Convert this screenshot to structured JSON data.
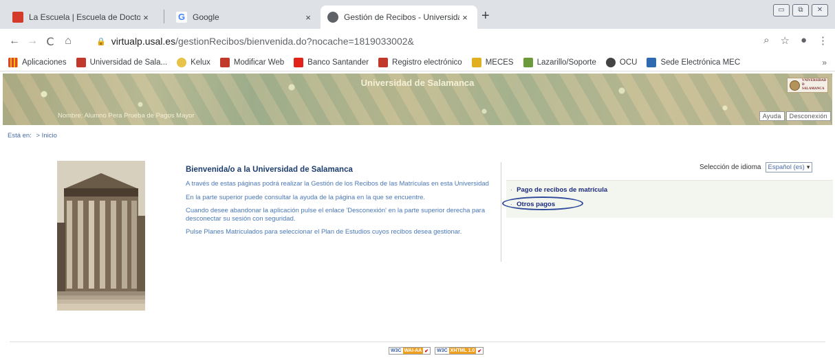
{
  "tabs": [
    {
      "title": "La Escuela | Escuela de Doctorado",
      "favicon_color": "#d43a2a",
      "active": false
    },
    {
      "title": "Google",
      "favicon_color": "#4285f4",
      "active": false
    },
    {
      "title": "Gestión de Recibos - Universidad",
      "favicon_color": "#5f6368",
      "active": true
    }
  ],
  "icons": {
    "close": "×",
    "new_tab": "+",
    "back": "←",
    "forward": "→",
    "reload": "C",
    "home": "⌂",
    "lock": "🔒",
    "zoom": "⌕",
    "star": "☆",
    "profile": "●",
    "menu": "⋮",
    "more": "»",
    "minimize": "▭",
    "restore": "⧉",
    "win_close": "✕",
    "bullet": "·",
    "chevron": "▾"
  },
  "address": {
    "host": "virtualp.usal.es",
    "path": "/gestionRecibos/bienvenida.do?nocache=1819033002&"
  },
  "bookmarks": [
    {
      "label": "Aplicaciones",
      "color": "#db4437"
    },
    {
      "label": "Universidad de Sala...",
      "color": "#c0392b"
    },
    {
      "label": "Kelux",
      "color": "#e8c34a"
    },
    {
      "label": "Modificar Web",
      "color": "#c0392b"
    },
    {
      "label": "Banco Santander",
      "color": "#e2231a"
    },
    {
      "label": "Registro electrónico",
      "color": "#c0392b"
    },
    {
      "label": "MECES",
      "color": "#e0b020"
    },
    {
      "label": "Lazarillo/Soporte",
      "color": "#6a9a3a"
    },
    {
      "label": "OCU",
      "color": "#444444"
    },
    {
      "label": "Sede Electrónica MEC",
      "color": "#2f6ab0"
    }
  ],
  "banner": {
    "title": "Universidad de Salamanca",
    "user_label": "Nombre: Alumno Pera Prueba de Pagos Mayor",
    "logo_lines": [
      "VNIVERSIDAD",
      "D SALAMANCA"
    ],
    "help_link": "Ayuda",
    "logout_link": "Desconexión"
  },
  "breadcrumb": {
    "prefix": "Está en:",
    "current": "> Inicio"
  },
  "welcome": {
    "heading": "Bienvenida/o a la Universidad de Salamanca",
    "paragraphs": [
      "A través de estas páginas podrá realizar la Gestión de los Recibos de las Matrículas en esta Universidad",
      "En la parte superior puede consultar la ayuda de la página en la que se encuentre.",
      "Cuando desee abandonar la aplicación pulse el enlace 'Desconexión' en la parte superior derecha para desconectar su sesión con seguridad.",
      "Pulse Planes Matriculados para seleccionar el Plan de Estudios cuyos recibos desea gestionar."
    ]
  },
  "language": {
    "label": "Selección de idioma",
    "selected": "Español (es)"
  },
  "menu": {
    "items": [
      "Pago de recibos de matrícula",
      "Otros pagos"
    ]
  },
  "footer": {
    "badge_prefix": "W3C",
    "badge1_level": "WAI-AA",
    "badge2_level": "XHTML 1.0"
  },
  "colors": {
    "link_blue": "#4a78b8",
    "menu_link": "#1a2a7c",
    "highlight_oval": "#2f4a9a"
  }
}
